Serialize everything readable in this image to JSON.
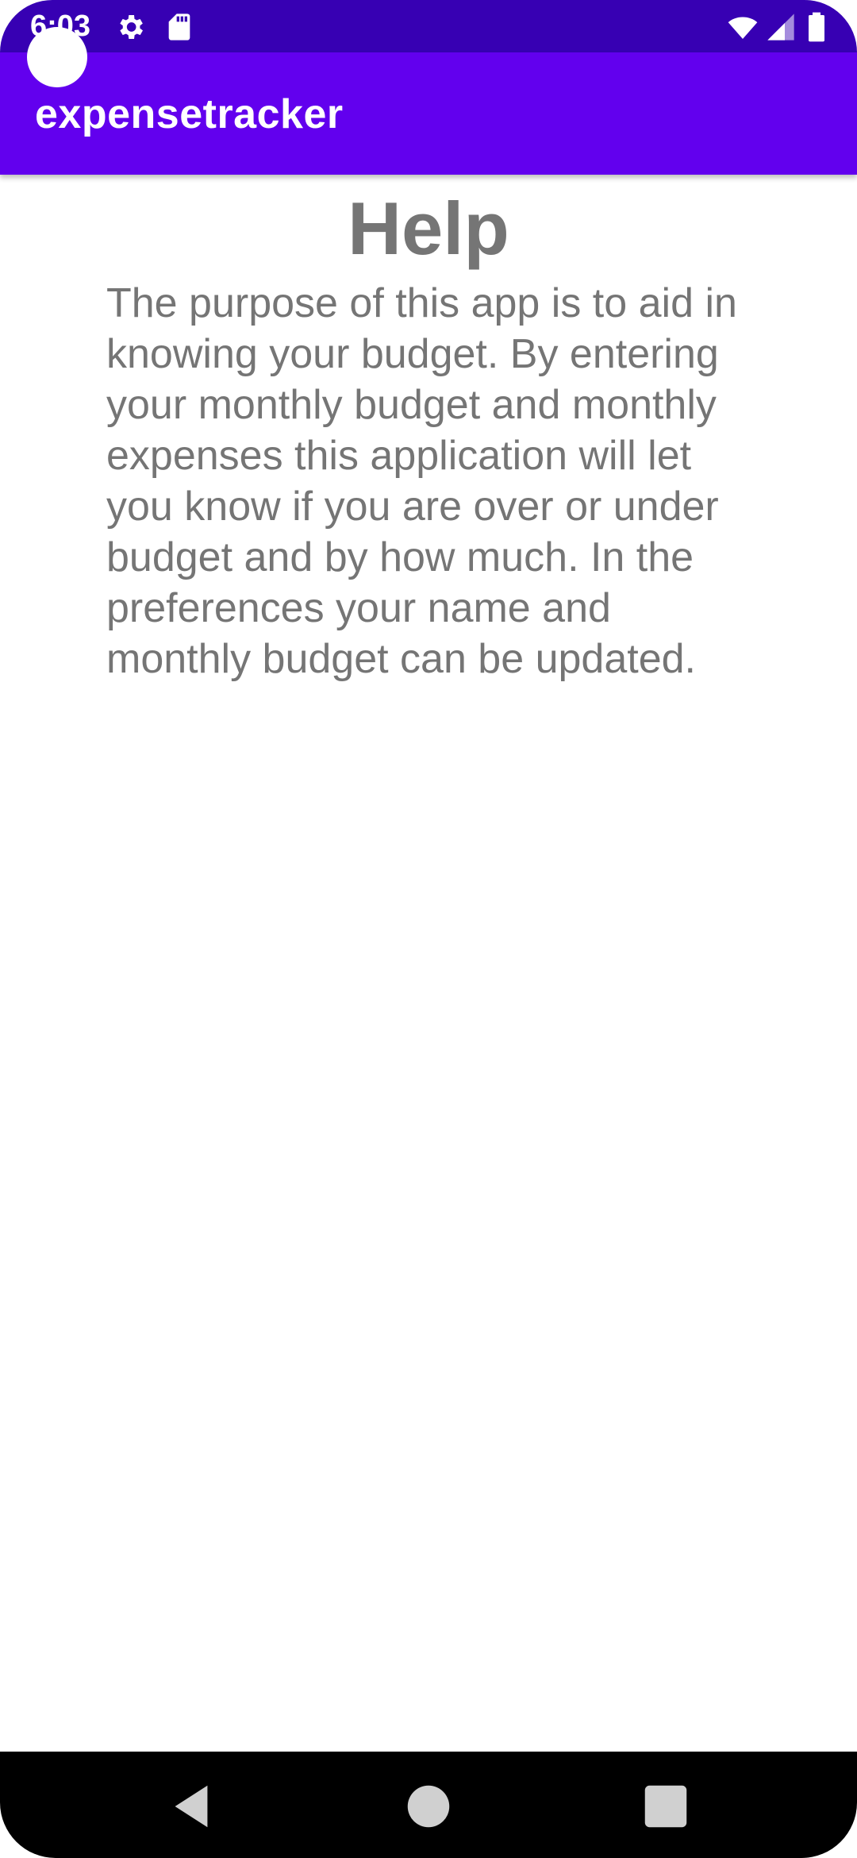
{
  "status_bar": {
    "time": "6:03",
    "icons": [
      "gear-icon",
      "sd-card-icon",
      "wifi-icon",
      "signal-icon",
      "battery-icon"
    ],
    "background": "#3700b3"
  },
  "app_bar": {
    "title": "expensetracker",
    "background": "#6200ee"
  },
  "main": {
    "heading": "Help",
    "body": "The purpose of this app is to aid in knowing your budget. By entering your monthly budget and monthly expenses this application will let you know if you are over or under budget and by how much. In the preferences your name and monthly budget can be updated.",
    "text_color": "#757575"
  },
  "nav_bar": {
    "buttons": [
      "back-icon",
      "home-icon",
      "recents-icon"
    ],
    "background": "#000000"
  }
}
